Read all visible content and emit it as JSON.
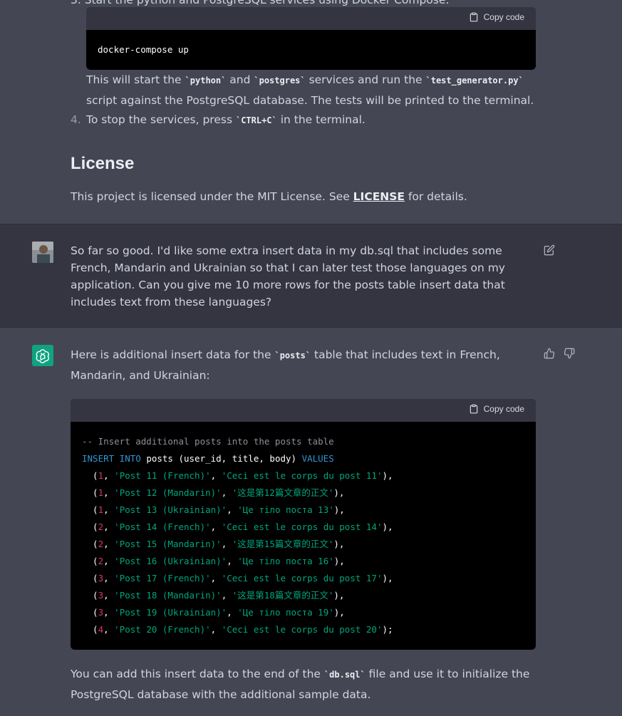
{
  "previous_answer": {
    "step3_partial": "3.  Start the python and PostgreSQL services using Docker Compose:",
    "code_block_1": {
      "copy_label": "Copy code",
      "code": "docker-compose up"
    },
    "step3_after_pre": "This will start the ",
    "python_code": "python",
    "and_text": " and ",
    "postgres_code": "postgres",
    "services_text": " services and run the ",
    "test_generator_code": "test_generator.py",
    "script_text": " script against the PostgreSQL database. The tests will be printed to the terminal.",
    "step4_number": "4.",
    "step4_pre": "To stop the services, press ",
    "ctrl_c_code": "CTRL+C",
    "step4_post": " in the terminal.",
    "license_heading": "License",
    "license_pre": "This project is licensed under the MIT License. See ",
    "license_link": "LICENSE",
    "license_post": " for details."
  },
  "user_message": {
    "text": "So far so good. I'd like some extra insert data in my db.sql that includes some French, Mandarin and Ukrainian so that I can later test those languages on my application. Can you give me 10 more rows for the posts table insert data that includes text from these languages?"
  },
  "assistant_message": {
    "intro_pre": "Here is additional insert data for the ",
    "posts_code": "posts",
    "intro_post": " table that includes text in French, Mandarin, and Ukrainian:",
    "code_block_2": {
      "copy_label": "Copy code",
      "comment": "-- Insert additional posts into the posts table",
      "kw_insert": "INSERT INTO",
      "table_cols": " posts (user_id, title, body) ",
      "kw_values": "VALUES",
      "rows": [
        {
          "id": "1",
          "title": "'Post 11 (French)'",
          "body": "'Ceci est le corps du post 11'",
          "end": "),"
        },
        {
          "id": "1",
          "title": "'Post 12 (Mandarin)'",
          "body": "'这是第12篇文章的正文'",
          "end": "),"
        },
        {
          "id": "1",
          "title": "'Post 13 (Ukrainian)'",
          "body": "'Це тіло поста 13'",
          "end": "),"
        },
        {
          "id": "2",
          "title": "'Post 14 (French)'",
          "body": "'Ceci est le corps du post 14'",
          "end": "),"
        },
        {
          "id": "2",
          "title": "'Post 15 (Mandarin)'",
          "body": "'这是第15篇文章的正文'",
          "end": "),"
        },
        {
          "id": "2",
          "title": "'Post 16 (Ukrainian)'",
          "body": "'Це тіло поста 16'",
          "end": "),"
        },
        {
          "id": "3",
          "title": "'Post 17 (French)'",
          "body": "'Ceci est le corps du post 17'",
          "end": "),"
        },
        {
          "id": "3",
          "title": "'Post 18 (Mandarin)'",
          "body": "'这是第18篇文章的正文'",
          "end": "),"
        },
        {
          "id": "3",
          "title": "'Post 19 (Ukrainian)'",
          "body": "'Це тіло поста 19'",
          "end": "),"
        },
        {
          "id": "4",
          "title": "'Post 20 (French)'",
          "body": "'Ceci est le corps du post 20'",
          "end": ");"
        }
      ]
    },
    "outro_pre": "You can add this insert data to the end of the ",
    "db_sql_code": "db.sql",
    "outro_post": " file and use it to initialize the PostgreSQL database with the additional sample data."
  },
  "icons": {
    "copy": "clipboard-icon",
    "edit": "edit-icon",
    "thumbs_up": "thumbs-up-icon",
    "thumbs_down": "thumbs-down-icon",
    "assistant_avatar": "openai-logo-icon",
    "user_avatar": "user-avatar"
  },
  "colors": {
    "assistant_bg": "#444654",
    "user_bg": "#343541",
    "accent_green": "#10a37f",
    "code_keyword": "#2e95d3",
    "code_number": "#df3079",
    "code_string": "#00a67d"
  }
}
